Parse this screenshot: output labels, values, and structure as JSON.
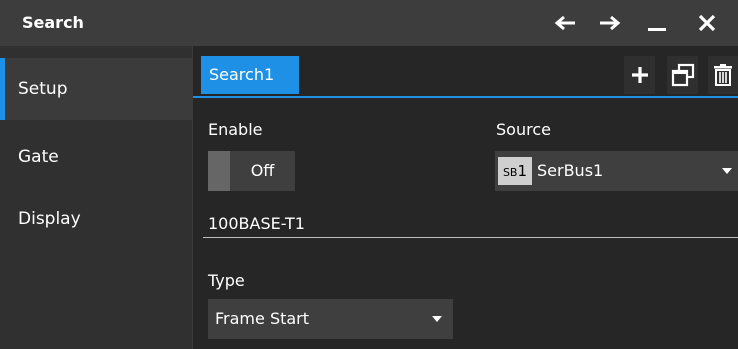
{
  "window": {
    "title": "Search"
  },
  "titlebar_buttons": {
    "back_icon": "arrow-left-icon",
    "forward_icon": "arrow-right-icon",
    "minimize_icon": "minimize-icon",
    "close_icon": "close-icon"
  },
  "sidebar": {
    "items": [
      {
        "label": "Setup",
        "active": true
      },
      {
        "label": "Gate",
        "active": false
      },
      {
        "label": "Display",
        "active": false
      }
    ]
  },
  "tabs": [
    {
      "label": "Search1",
      "active": true
    }
  ],
  "tab_tools": {
    "add_icon": "plus-icon",
    "copy_icon": "windows-copy-icon",
    "delete_icon": "trash-icon"
  },
  "enable": {
    "label": "Enable",
    "state_text": "Off"
  },
  "source": {
    "label": "Source",
    "badge_prefix": "SB",
    "badge_number": "1",
    "value": "SerBus1"
  },
  "protocol": {
    "text": "100BASE-T1"
  },
  "type": {
    "label": "Type",
    "value": "Frame Start"
  },
  "colors": {
    "accent": "#1e90e6",
    "background": "#262626",
    "titlebar": "#3d3d3d",
    "sidebar": "#303030",
    "control": "#3f3f3f"
  }
}
